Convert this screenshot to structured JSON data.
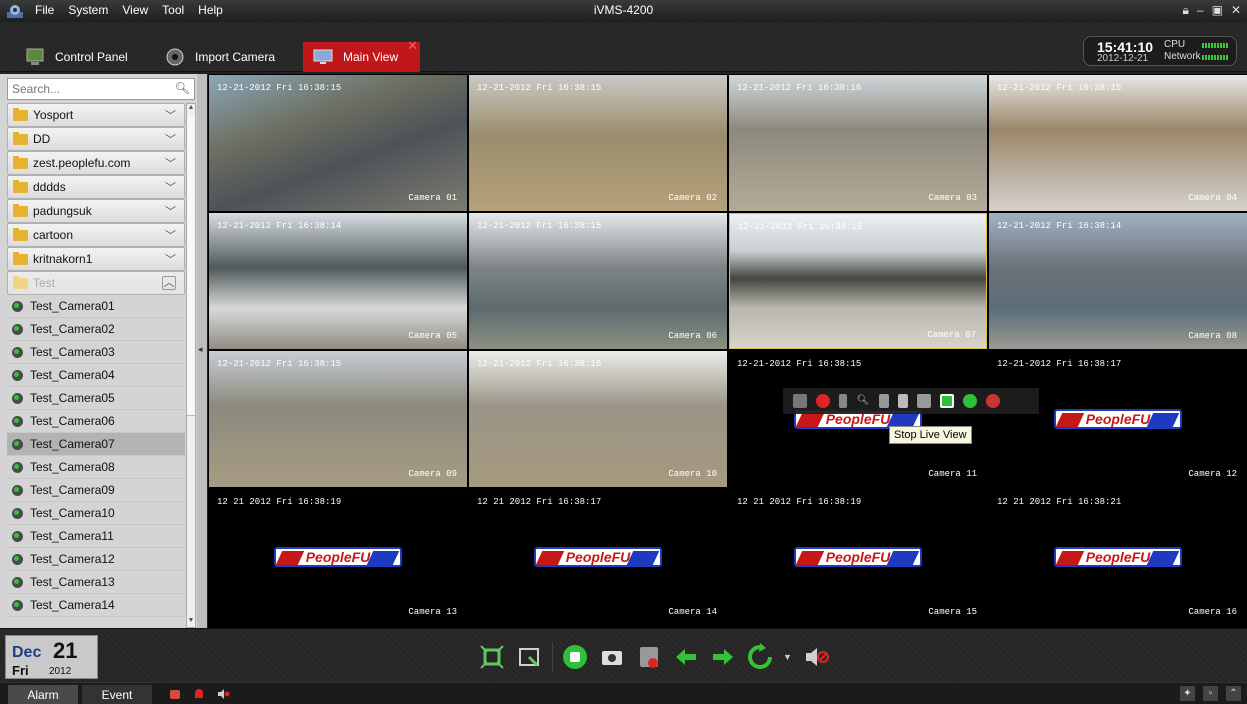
{
  "titlebar": {
    "menus": [
      "File",
      "System",
      "View",
      "Tool",
      "Help"
    ],
    "title": "iVMS-4200"
  },
  "tabs": {
    "control_panel": "Control Panel",
    "import_camera": "Import Camera",
    "main_view": "Main View"
  },
  "clock": {
    "time": "15:41:10",
    "date": "2012-12-21",
    "cpu_label": "CPU",
    "network_label": "Network"
  },
  "sidebar": {
    "search_placeholder": "Search...",
    "groups": [
      "Yosport",
      "DD",
      "zest.peoplefu.com",
      "dddds",
      "padungsuk",
      "cartoon",
      "kritnakorn1",
      "Test"
    ],
    "cameras": [
      "Test_Camera01",
      "Test_Camera02",
      "Test_Camera03",
      "Test_Camera04",
      "Test_Camera05",
      "Test_Camera06",
      "Test_Camera07",
      "Test_Camera08",
      "Test_Camera09",
      "Test_Camera10",
      "Test_Camera11",
      "Test_Camera12",
      "Test_Camera13",
      "Test_Camera14"
    ],
    "selected_camera": "Test_Camera07"
  },
  "tiles": [
    {
      "ts": "12-21-2012 Fri 16:38:15",
      "name": "Camera 01"
    },
    {
      "ts": "12-21-2012 Fri 16:38:15",
      "name": "Camera 02"
    },
    {
      "ts": "12-21-2012 Fri 16:38:16",
      "name": "Camera 03"
    },
    {
      "ts": "12-21-2012 Fri 16:38:15",
      "name": "Camera 04"
    },
    {
      "ts": "12-21-2012 Fri 16:38:14",
      "name": "Camera 05"
    },
    {
      "ts": "12-21-2012 Fri 16:38:15",
      "name": "Camera 06"
    },
    {
      "ts": "12-21-2012 Fri 16:38:15",
      "name": "Camera 07"
    },
    {
      "ts": "12-21-2012 Fri 16:38:14",
      "name": "Camera 08"
    },
    {
      "ts": "12-21-2012 Fri 16:38:15",
      "name": "Camera 09"
    },
    {
      "ts": "12-21-2012 Fri 16:38:16",
      "name": "Camera 10"
    },
    {
      "ts": "12-21-2012 Fri 16:38:15",
      "name": "Camera 11"
    },
    {
      "ts": "12-21-2012 Fri 16:38:17",
      "name": "Camera 12"
    },
    {
      "ts": "12 21 2012 Fri 16:38:19",
      "name": "Camera 13"
    },
    {
      "ts": "12 21 2012 Fri 16:38:17",
      "name": "Camera 14"
    },
    {
      "ts": "12 21 2012 Fri 16:38:19",
      "name": "Camera 15"
    },
    {
      "ts": "12 21 2012 Fri 16:38:21",
      "name": "Camera 16"
    }
  ],
  "logo_text": "PeopleFU",
  "tooltip": "Stop Live View",
  "date_box": {
    "month": "Dec",
    "day": "21",
    "weekday": "Fri",
    "year": "2012"
  },
  "statusbar": {
    "alarm": "Alarm",
    "event": "Event"
  },
  "colors": {
    "accent_red": "#c0171a",
    "active_border": "#d8c43a",
    "green": "#2fd12f"
  }
}
